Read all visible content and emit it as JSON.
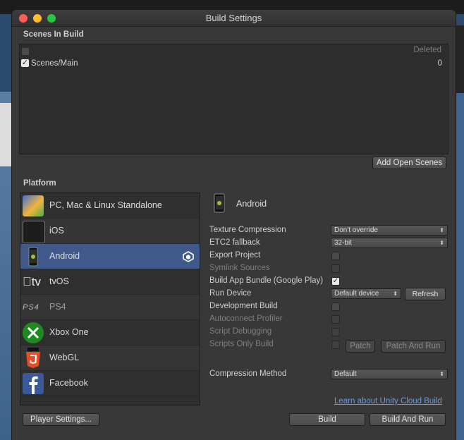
{
  "window": {
    "title": "Build Settings"
  },
  "scenes": {
    "header": "Scenes In Build",
    "deleted_label": "Deleted",
    "items": [
      {
        "name": "Scenes/Main",
        "index": "0",
        "checked": true
      }
    ],
    "add_open_scenes": "Add Open Scenes"
  },
  "platform": {
    "header": "Platform",
    "items": [
      {
        "name": "PC, Mac & Linux Standalone",
        "icon": "pc-mac-linux-icon"
      },
      {
        "name": "iOS",
        "icon": "ios-device-icon"
      },
      {
        "name": "Android",
        "icon": "android-phone-icon",
        "selected": true
      },
      {
        "name": "tvOS",
        "logo": "tv"
      },
      {
        "name": "PS4",
        "logo": "PS4"
      },
      {
        "name": "Xbox One",
        "icon": "xbox-icon"
      },
      {
        "name": "WebGL",
        "icon": "html5-icon"
      },
      {
        "name": "Facebook",
        "icon": "facebook-icon"
      }
    ]
  },
  "settings": {
    "platform_title": "Android",
    "texture_compression": {
      "label": "Texture Compression",
      "value": "Don't override"
    },
    "etc2_fallback": {
      "label": "ETC2 fallback",
      "value": "32-bit"
    },
    "export_project": {
      "label": "Export Project",
      "checked": false
    },
    "symlink_sources": {
      "label": "Symlink Sources",
      "checked": false
    },
    "build_app_bundle": {
      "label": "Build App Bundle (Google Play)",
      "checked": true
    },
    "run_device": {
      "label": "Run Device",
      "value": "Default device",
      "refresh": "Refresh"
    },
    "development_build": {
      "label": "Development Build",
      "checked": false
    },
    "autoconnect_profiler": {
      "label": "Autoconnect Profiler",
      "checked": false
    },
    "script_debugging": {
      "label": "Script Debugging",
      "checked": false
    },
    "scripts_only_build": {
      "label": "Scripts Only Build",
      "checked": false,
      "patch": "Patch",
      "patch_and_run": "Patch And Run"
    },
    "compression_method": {
      "label": "Compression Method",
      "value": "Default"
    }
  },
  "footer": {
    "cloud_link": "Learn about Unity Cloud Build",
    "player_settings": "Player Settings...",
    "build": "Build",
    "build_and_run": "Build And Run"
  },
  "colors": {
    "selection": "#3f5a8a",
    "link": "#6d9bdb",
    "panel": "#383838"
  }
}
